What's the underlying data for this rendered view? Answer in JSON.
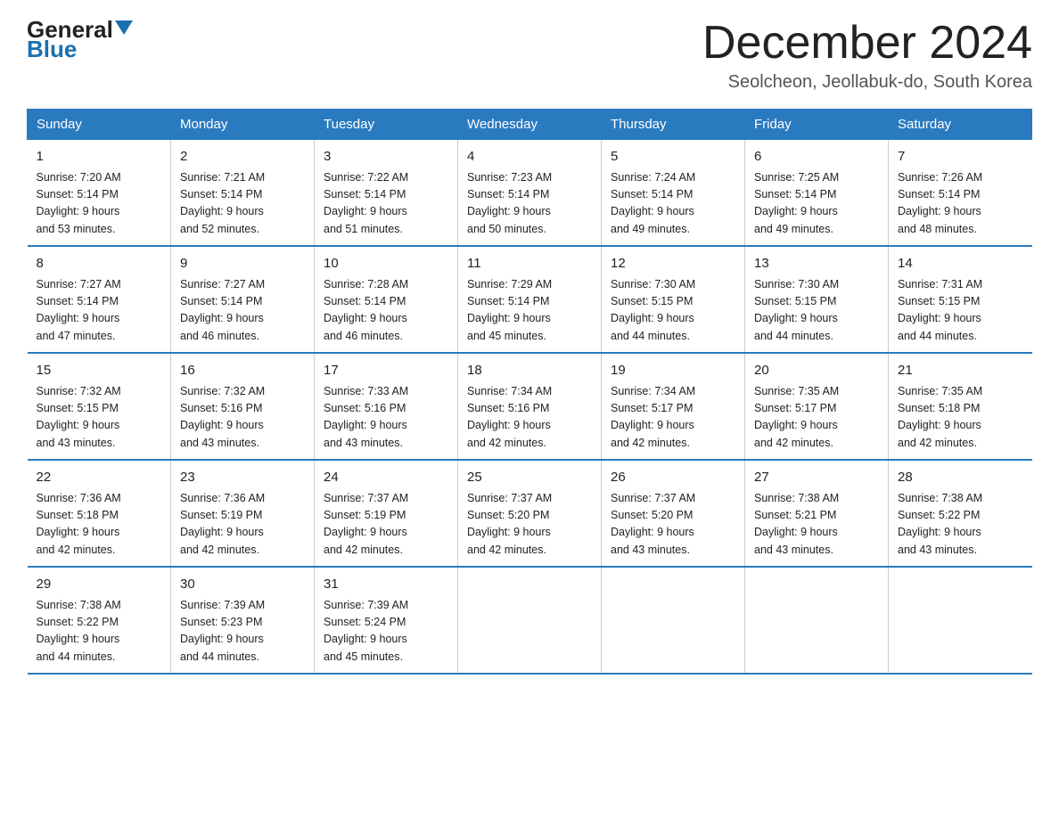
{
  "logo": {
    "general": "General",
    "triangle": "",
    "blue": "Blue"
  },
  "title": "December 2024",
  "subtitle": "Seolcheon, Jeollabuk-do, South Korea",
  "headers": [
    "Sunday",
    "Monday",
    "Tuesday",
    "Wednesday",
    "Thursday",
    "Friday",
    "Saturday"
  ],
  "weeks": [
    [
      {
        "day": "1",
        "info": "Sunrise: 7:20 AM\nSunset: 5:14 PM\nDaylight: 9 hours\nand 53 minutes."
      },
      {
        "day": "2",
        "info": "Sunrise: 7:21 AM\nSunset: 5:14 PM\nDaylight: 9 hours\nand 52 minutes."
      },
      {
        "day": "3",
        "info": "Sunrise: 7:22 AM\nSunset: 5:14 PM\nDaylight: 9 hours\nand 51 minutes."
      },
      {
        "day": "4",
        "info": "Sunrise: 7:23 AM\nSunset: 5:14 PM\nDaylight: 9 hours\nand 50 minutes."
      },
      {
        "day": "5",
        "info": "Sunrise: 7:24 AM\nSunset: 5:14 PM\nDaylight: 9 hours\nand 49 minutes."
      },
      {
        "day": "6",
        "info": "Sunrise: 7:25 AM\nSunset: 5:14 PM\nDaylight: 9 hours\nand 49 minutes."
      },
      {
        "day": "7",
        "info": "Sunrise: 7:26 AM\nSunset: 5:14 PM\nDaylight: 9 hours\nand 48 minutes."
      }
    ],
    [
      {
        "day": "8",
        "info": "Sunrise: 7:27 AM\nSunset: 5:14 PM\nDaylight: 9 hours\nand 47 minutes."
      },
      {
        "day": "9",
        "info": "Sunrise: 7:27 AM\nSunset: 5:14 PM\nDaylight: 9 hours\nand 46 minutes."
      },
      {
        "day": "10",
        "info": "Sunrise: 7:28 AM\nSunset: 5:14 PM\nDaylight: 9 hours\nand 46 minutes."
      },
      {
        "day": "11",
        "info": "Sunrise: 7:29 AM\nSunset: 5:14 PM\nDaylight: 9 hours\nand 45 minutes."
      },
      {
        "day": "12",
        "info": "Sunrise: 7:30 AM\nSunset: 5:15 PM\nDaylight: 9 hours\nand 44 minutes."
      },
      {
        "day": "13",
        "info": "Sunrise: 7:30 AM\nSunset: 5:15 PM\nDaylight: 9 hours\nand 44 minutes."
      },
      {
        "day": "14",
        "info": "Sunrise: 7:31 AM\nSunset: 5:15 PM\nDaylight: 9 hours\nand 44 minutes."
      }
    ],
    [
      {
        "day": "15",
        "info": "Sunrise: 7:32 AM\nSunset: 5:15 PM\nDaylight: 9 hours\nand 43 minutes."
      },
      {
        "day": "16",
        "info": "Sunrise: 7:32 AM\nSunset: 5:16 PM\nDaylight: 9 hours\nand 43 minutes."
      },
      {
        "day": "17",
        "info": "Sunrise: 7:33 AM\nSunset: 5:16 PM\nDaylight: 9 hours\nand 43 minutes."
      },
      {
        "day": "18",
        "info": "Sunrise: 7:34 AM\nSunset: 5:16 PM\nDaylight: 9 hours\nand 42 minutes."
      },
      {
        "day": "19",
        "info": "Sunrise: 7:34 AM\nSunset: 5:17 PM\nDaylight: 9 hours\nand 42 minutes."
      },
      {
        "day": "20",
        "info": "Sunrise: 7:35 AM\nSunset: 5:17 PM\nDaylight: 9 hours\nand 42 minutes."
      },
      {
        "day": "21",
        "info": "Sunrise: 7:35 AM\nSunset: 5:18 PM\nDaylight: 9 hours\nand 42 minutes."
      }
    ],
    [
      {
        "day": "22",
        "info": "Sunrise: 7:36 AM\nSunset: 5:18 PM\nDaylight: 9 hours\nand 42 minutes."
      },
      {
        "day": "23",
        "info": "Sunrise: 7:36 AM\nSunset: 5:19 PM\nDaylight: 9 hours\nand 42 minutes."
      },
      {
        "day": "24",
        "info": "Sunrise: 7:37 AM\nSunset: 5:19 PM\nDaylight: 9 hours\nand 42 minutes."
      },
      {
        "day": "25",
        "info": "Sunrise: 7:37 AM\nSunset: 5:20 PM\nDaylight: 9 hours\nand 42 minutes."
      },
      {
        "day": "26",
        "info": "Sunrise: 7:37 AM\nSunset: 5:20 PM\nDaylight: 9 hours\nand 43 minutes."
      },
      {
        "day": "27",
        "info": "Sunrise: 7:38 AM\nSunset: 5:21 PM\nDaylight: 9 hours\nand 43 minutes."
      },
      {
        "day": "28",
        "info": "Sunrise: 7:38 AM\nSunset: 5:22 PM\nDaylight: 9 hours\nand 43 minutes."
      }
    ],
    [
      {
        "day": "29",
        "info": "Sunrise: 7:38 AM\nSunset: 5:22 PM\nDaylight: 9 hours\nand 44 minutes."
      },
      {
        "day": "30",
        "info": "Sunrise: 7:39 AM\nSunset: 5:23 PM\nDaylight: 9 hours\nand 44 minutes."
      },
      {
        "day": "31",
        "info": "Sunrise: 7:39 AM\nSunset: 5:24 PM\nDaylight: 9 hours\nand 45 minutes."
      },
      {
        "day": "",
        "info": ""
      },
      {
        "day": "",
        "info": ""
      },
      {
        "day": "",
        "info": ""
      },
      {
        "day": "",
        "info": ""
      }
    ]
  ]
}
